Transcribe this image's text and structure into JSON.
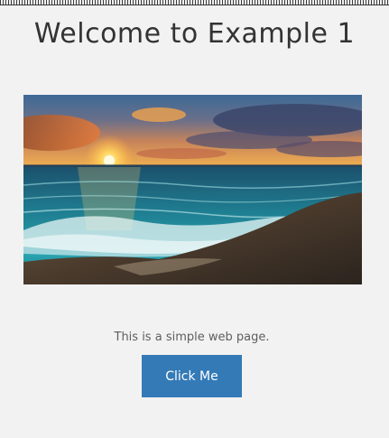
{
  "page": {
    "title": "Welcome to Example 1",
    "description": "This is a simple web page."
  },
  "hero": {
    "image_subject": "sunset-beach-waves"
  },
  "button": {
    "label": "Click Me"
  },
  "colors": {
    "background": "#f2f2f2",
    "title_text": "#333333",
    "body_text": "#5e5e5e",
    "button_bg": "#337ab7",
    "button_text": "#ffffff"
  }
}
